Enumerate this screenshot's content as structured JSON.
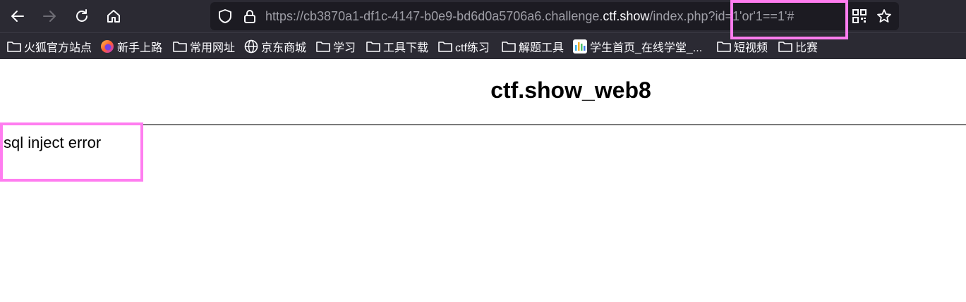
{
  "browser": {
    "url_prefix": "https://cb3870a1-df1c-4147-b0e9-bd6d0a5706a6.challenge.",
    "url_host": "ctf.show",
    "url_suffix": "/index.php?id=1'or'1==1'#"
  },
  "bookmarks": [
    {
      "label": "火狐官方站点",
      "icon": "folder-icon"
    },
    {
      "label": "新手上路",
      "icon": "firefox-icon"
    },
    {
      "label": "常用网址",
      "icon": "folder-icon"
    },
    {
      "label": "京东商城",
      "icon": "globe-icon"
    },
    {
      "label": "学习",
      "icon": "folder-icon"
    },
    {
      "label": "工具下载",
      "icon": "folder-icon"
    },
    {
      "label": "ctf练习",
      "icon": "folder-icon"
    },
    {
      "label": "解题工具",
      "icon": "folder-icon"
    },
    {
      "label": "学生首页_在线学堂_...",
      "icon": "site-icon"
    },
    {
      "label": "短视频",
      "icon": "folder-icon"
    },
    {
      "label": "比赛",
      "icon": "folder-icon"
    }
  ],
  "page": {
    "title": "ctf.show_web8",
    "message": "sql inject error"
  },
  "colors": {
    "highlight": "#ff7df0",
    "toolbar": "#2b2a33",
    "urlbar": "#1c1b22"
  }
}
